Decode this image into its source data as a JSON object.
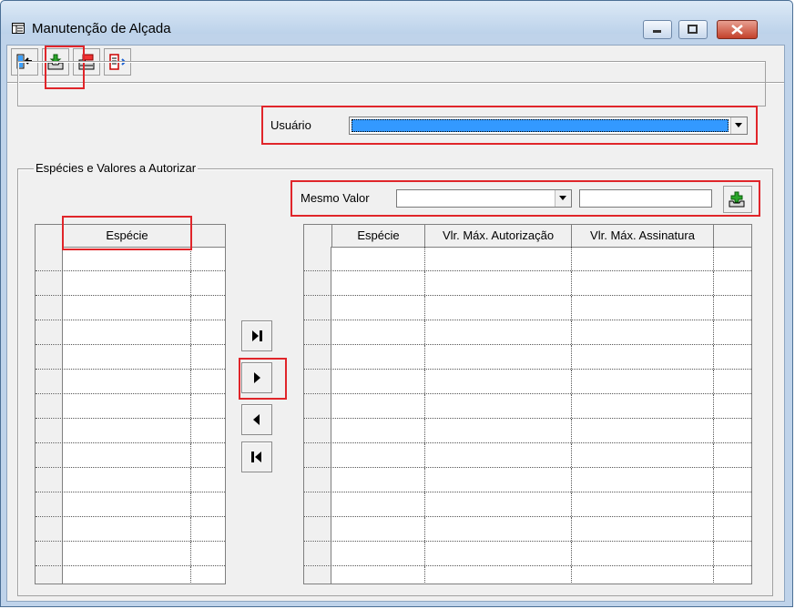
{
  "window": {
    "title": "Manutenção de Alçada"
  },
  "toolbar": {
    "buttons": [
      {
        "icon": "exit-icon"
      },
      {
        "icon": "save-icon"
      },
      {
        "icon": "open-folder-icon"
      },
      {
        "icon": "export-icon"
      }
    ]
  },
  "user": {
    "label": "Usuário",
    "value": ""
  },
  "group": {
    "title": "Espécies e Valores a Autorizar",
    "same_value": {
      "label": "Mesmo Valor",
      "select_value": "",
      "input_value": ""
    }
  },
  "left_grid": {
    "headers": [
      "Espécie"
    ],
    "row_count": 14
  },
  "right_grid": {
    "headers": [
      "Espécie",
      "Vlr. Máx. Autorização",
      "Vlr. Máx. Assinatura"
    ],
    "row_count": 14
  },
  "colors": {
    "highlight": "#e0252a",
    "selected_field": "#3399ff"
  }
}
